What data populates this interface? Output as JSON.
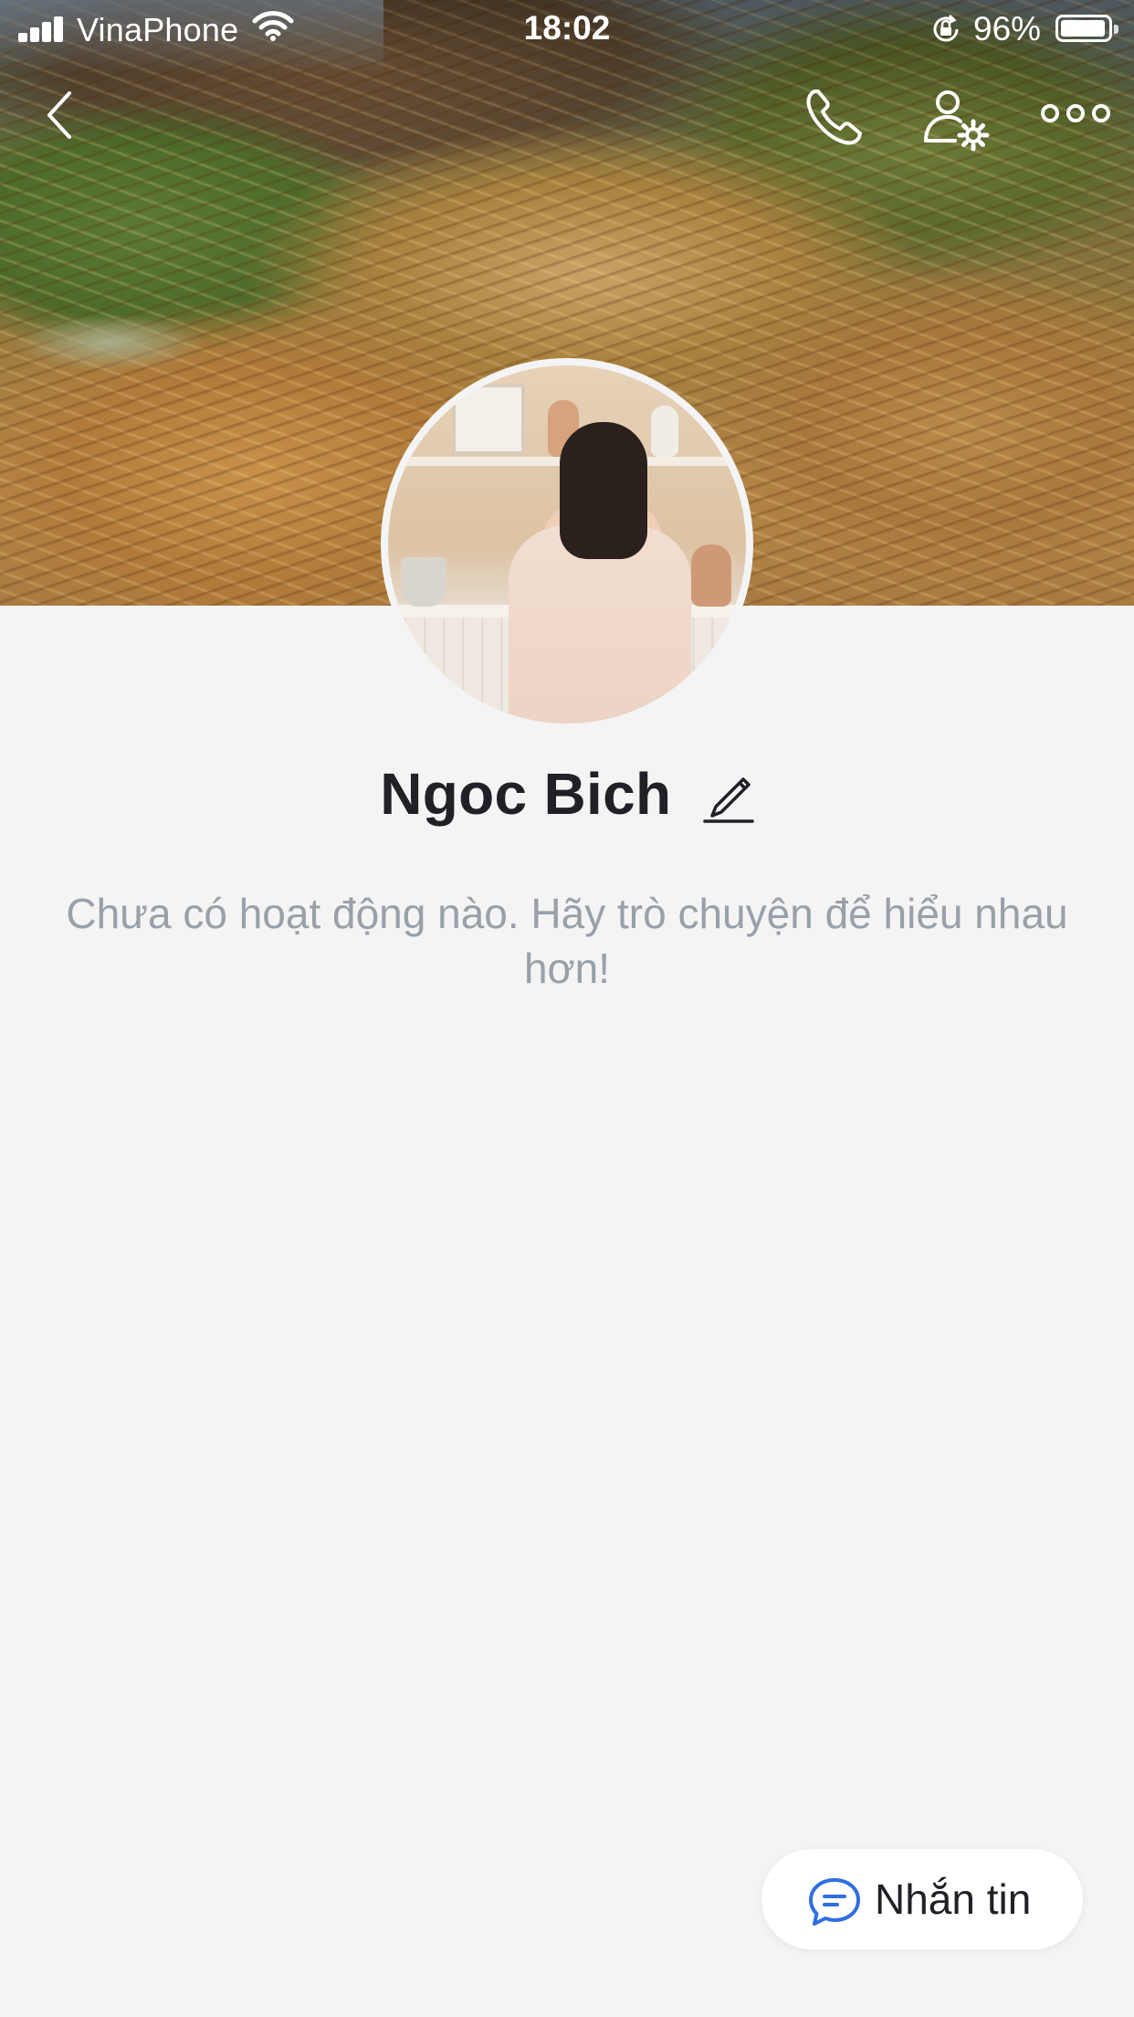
{
  "status_bar": {
    "carrier": "VinaPhone",
    "time": "18:02",
    "battery_percent": "96%",
    "battery_level": 0.96
  },
  "nav": {
    "back_icon": "chevron-left-icon",
    "call_icon": "phone-icon",
    "settings_icon": "user-settings-icon",
    "more_icon": "more-horizontal-icon"
  },
  "profile": {
    "name": "Ngoc Bich",
    "edit_icon": "pencil-icon",
    "empty_message": "Chưa có hoạt động nào. Hãy trò chuyện để hiểu nhau hơn!"
  },
  "actions": {
    "message_label": "Nhắn tin",
    "message_icon": "chat-bubble-icon"
  },
  "colors": {
    "background": "#f4f4f5",
    "name_text": "#1f2126",
    "muted_text": "#9aa0a8",
    "accent_blue": "#2f6fe0"
  }
}
